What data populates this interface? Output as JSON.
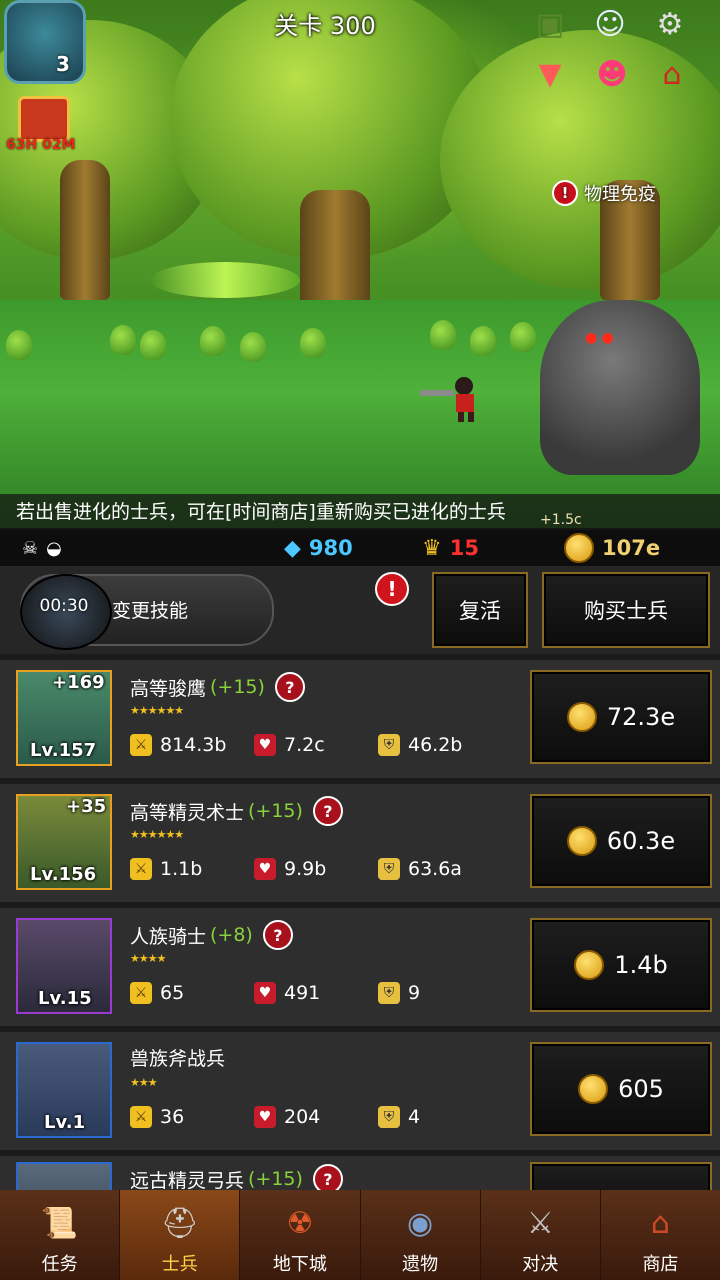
{
  "level_title": "关卡 300",
  "player": {
    "level": "3"
  },
  "gift": {
    "timer": "63H 02M"
  },
  "top_icons": [
    "box-icon",
    "angel-icon",
    "settings-icon",
    "triangle-down-icon",
    "characters-icon",
    "house-icon"
  ],
  "battle": {
    "status_badge": "物理免疫",
    "alert": "!",
    "float_damage": "+1.5c"
  },
  "tip": "若出售进化的士兵，可在[时间商店]重新购买已进化的士兵",
  "resources": {
    "gems": "980",
    "medals": "15",
    "gold": "107e"
  },
  "controls": {
    "skill_timer": "00:30",
    "skill_label": "变更技能",
    "skill_alert": "!",
    "revive_label": "复活",
    "buy_soldier_label": "购买士兵"
  },
  "soldiers": [
    {
      "name": "高等骏鹰",
      "plus": "(+15)",
      "bonus": "+169",
      "level": "Lv.157",
      "stars": "★★★★★★",
      "atk": "814.3b",
      "hp": "7.2c",
      "def": "46.2b",
      "price": "72.3e",
      "qmark": "?",
      "frame": "#e8a020"
    },
    {
      "name": "高等精灵术士",
      "plus": "(+15)",
      "bonus": "+35",
      "level": "Lv.156",
      "stars": "★★★★★★",
      "atk": "1.1b",
      "hp": "9.9b",
      "def": "63.6a",
      "price": "60.3e",
      "qmark": "?",
      "frame": "#e8a020"
    },
    {
      "name": "人族骑士",
      "plus": "(+8)",
      "bonus": "",
      "level": "Lv.15",
      "stars": "★★★★",
      "atk": "65",
      "hp": "491",
      "def": "9",
      "price": "1.4b",
      "qmark": "?",
      "frame": "#9a3ad0"
    },
    {
      "name": "兽族斧战兵",
      "plus": "",
      "bonus": "",
      "level": "Lv.1",
      "stars": "★★★",
      "atk": "36",
      "hp": "204",
      "def": "4",
      "price": "605",
      "qmark": "",
      "frame": "#2a6ad0"
    },
    {
      "name": "远古精灵弓兵",
      "plus": "(+15)",
      "qmark": "?",
      "frame": "#2a6ad0"
    }
  ],
  "nav": [
    {
      "label": "任务",
      "icon": "scroll-icon"
    },
    {
      "label": "士兵",
      "icon": "helmet-icon"
    },
    {
      "label": "地下城",
      "icon": "monster-icon"
    },
    {
      "label": "遗物",
      "icon": "orb-icon"
    },
    {
      "label": "对决",
      "icon": "swords-icon"
    },
    {
      "label": "商店",
      "icon": "shop-icon"
    }
  ],
  "colors": {
    "accent_gold": "#f0c020",
    "plus_green": "#8ad23a",
    "alert_red": "#c8101c",
    "gem_blue": "#4ac8ff",
    "medal_red": "#ff3030"
  }
}
